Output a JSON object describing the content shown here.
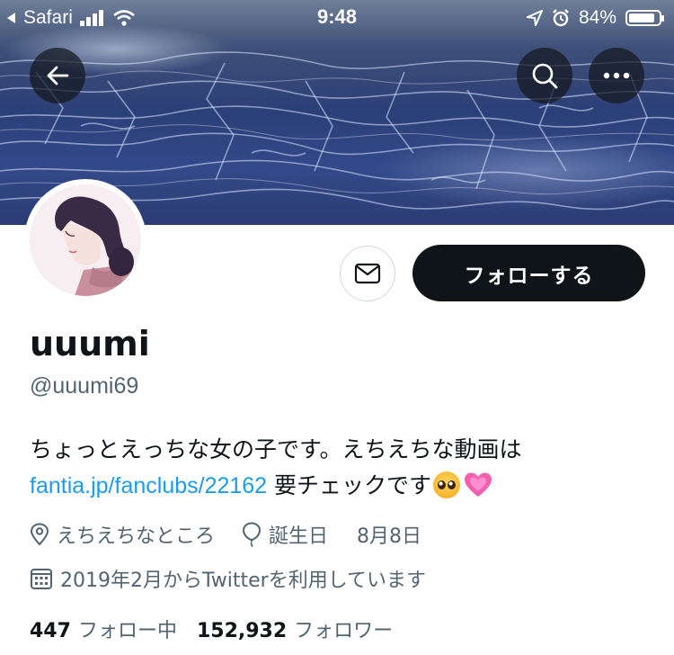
{
  "status_bar": {
    "carrier": "Safari",
    "time": "9:48",
    "battery": "84%"
  },
  "header": {
    "back_icon": "arrow-left-icon",
    "search_icon": "search-icon",
    "more_icon": "more-horizontal-icon"
  },
  "profile": {
    "display_name": "uuumi",
    "handle": "@uuumi69",
    "bio_line1": "ちょっとえっちな女の子です。えちえちな動画は",
    "bio_link": "fantia.jp/fanclubs/22162",
    "bio_after_link": " 要チェックです",
    "emojis": [
      "pleading-face-emoji",
      "growing-heart-emoji"
    ],
    "location": "えちえちなところ",
    "birthday_label": "誕生日",
    "birthday_date": "8月8日",
    "joined": "2019年2月からTwitterを利用しています",
    "following_count": "447",
    "following_label": "フォロー中",
    "followers_count": "152,932",
    "followers_label": "フォロワー"
  },
  "actions": {
    "message_icon": "mail-icon",
    "follow_label": "フォローする"
  },
  "colors": {
    "link": "#1d9bf0",
    "secondary_text": "#536471",
    "follow_button": "#0f1419"
  }
}
